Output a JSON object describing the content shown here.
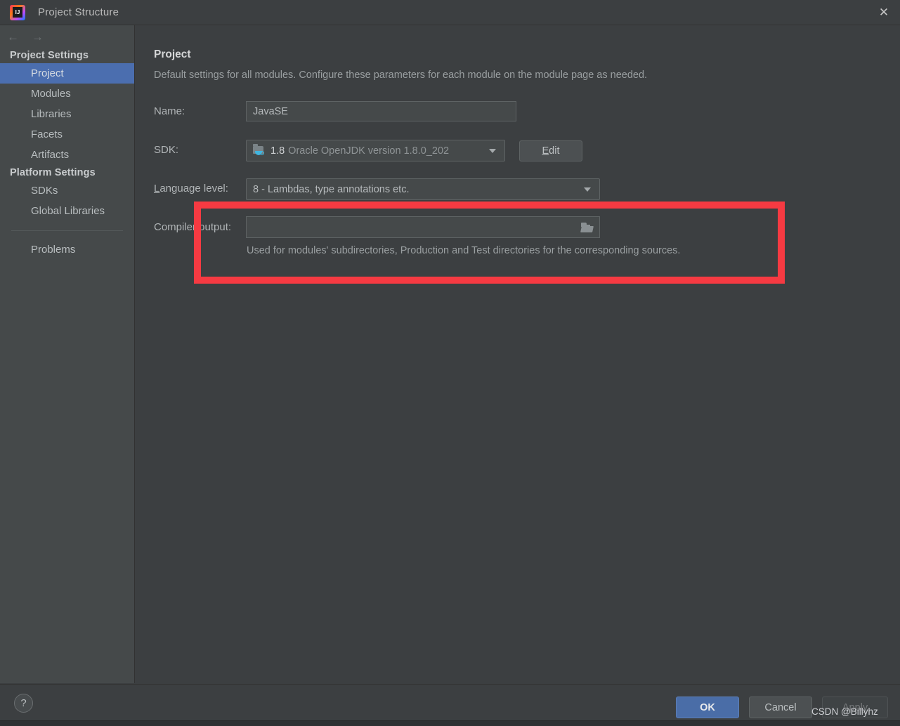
{
  "window": {
    "title": "Project Structure",
    "app_icon": "intellij-idea-icon",
    "close_icon": "✕"
  },
  "sidebar": {
    "back_arrow": "←",
    "forward_arrow": "→",
    "sections": [
      {
        "header": "Project Settings",
        "items": [
          {
            "label": "Project",
            "selected": true
          },
          {
            "label": "Modules",
            "selected": false
          },
          {
            "label": "Libraries",
            "selected": false
          },
          {
            "label": "Facets",
            "selected": false
          },
          {
            "label": "Artifacts",
            "selected": false
          }
        ]
      },
      {
        "header": "Platform Settings",
        "items": [
          {
            "label": "SDKs",
            "selected": false
          },
          {
            "label": "Global Libraries",
            "selected": false
          }
        ]
      }
    ],
    "problems_label": "Problems"
  },
  "main": {
    "title": "Project",
    "description": "Default settings for all modules. Configure these parameters for each module on the module page as needed.",
    "name_row": {
      "label": "Name:",
      "value": "JavaSE",
      "placeholder": ""
    },
    "sdk_row": {
      "label": "SDK:",
      "icon": "java-sdk-folder-icon",
      "version": "1.8",
      "detail": "Oracle OpenJDK version 1.8.0_202",
      "dropdown_icon": "chevron-down-icon",
      "edit_button": {
        "mnemonic": "E",
        "rest": "dit"
      }
    },
    "language_level_row": {
      "label_mnemonic": "L",
      "label_rest": "anguage level:",
      "value": "8 - Lambdas, type annotations etc.",
      "dropdown_icon": "chevron-down-icon"
    },
    "compiler_output_row": {
      "label": "Compiler output:",
      "value": "",
      "browse_icon": "open-folder-icon",
      "hint": "Used for modules' subdirectories, Production and Test directories for the corresponding sources."
    }
  },
  "annotation": {
    "color": "#f63a42",
    "shape": "rectangle"
  },
  "footer": {
    "help_label": "?",
    "ok_label": "OK",
    "cancel_label": "Cancel",
    "apply_label": "Apply"
  },
  "watermark": {
    "text": "CSDN @Billyhz"
  }
}
